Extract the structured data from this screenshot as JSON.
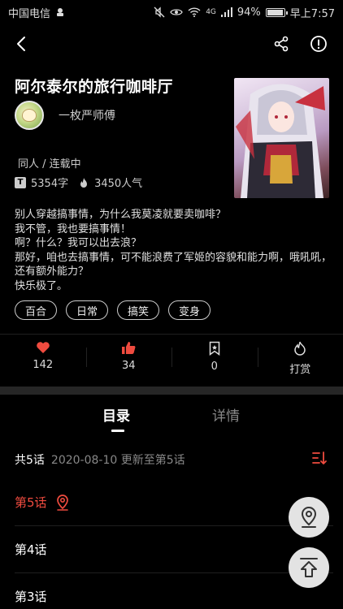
{
  "status_bar": {
    "carrier": "中国电信",
    "battery": "94%",
    "battery_level": 0.94,
    "signal_label": "4G",
    "time": "早上7:57"
  },
  "book": {
    "title": "阿尔泰尔的旅行咖啡厅",
    "author": "一枚严师傅",
    "meta": "同人 / 连载中",
    "word_count": "5354字",
    "popularity": "3450人气",
    "description": [
      "别人穿越搞事情，为什么我莫凌就要卖咖啡？",
      "我不管，我也要搞事情！",
      "啊？什么？我可以出去浪？",
      "那好，咱也去搞事情，可不能浪费了军姬的容貌和能力啊，哦吼吼，还有额外能力？",
      "快乐极了。"
    ],
    "tags": [
      "百合",
      "日常",
      "搞笑",
      "变身"
    ]
  },
  "actions": [
    {
      "icon": "heart-icon",
      "label": "142"
    },
    {
      "icon": "thumbs-up-icon",
      "label": "34"
    },
    {
      "icon": "bookmark-icon",
      "label": "0"
    },
    {
      "icon": "flame-icon",
      "label": "打赏"
    }
  ],
  "tabs": {
    "catalog": "目录",
    "detail": "详情"
  },
  "catalog": {
    "count": "共5话",
    "update": "2020-08-10 更新至第5话",
    "chapters": [
      {
        "title": "第5话",
        "current": true
      },
      {
        "title": "第4话",
        "current": false
      },
      {
        "title": "第3话",
        "current": false
      }
    ]
  },
  "colors": {
    "accent": "#ef4b3f",
    "background": "#000000",
    "divider": "#262626"
  }
}
